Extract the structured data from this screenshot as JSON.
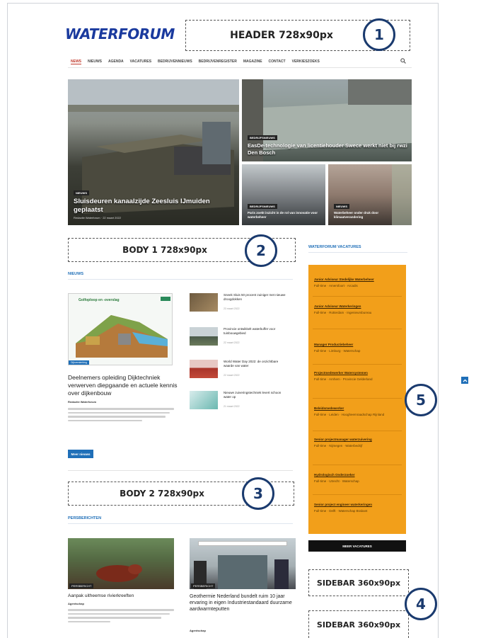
{
  "header": {
    "logo": "WATERFORUM",
    "ad_label": "HEADER 728x90px",
    "badge": "1"
  },
  "nav": {
    "items": [
      "NEWS",
      "NIEUWS",
      "AGENDA",
      "VACATURES",
      "BEDRIJVENNIEUWS",
      "BEDRIJVENREGISTER",
      "MAGAZINE",
      "CONTACT",
      "VERKIESZOEKS"
    ],
    "active": "NEWS",
    "search_icon": "search-icon"
  },
  "hero": {
    "main": {
      "tag": "Nieuws",
      "title": "Sluisdeuren kanaalzijde Zeesluis IJmuiden geplaatst",
      "meta": "Redactie Waterforum · 22 maart 2022"
    },
    "top_right": {
      "tag": "Bedrijfsnieuws",
      "title": "EasDe-technologie van licentiehouder Swece werkt niet bij rwzi Den Bosch"
    },
    "bottom_left": {
      "tag": "Bedrijfsnieuws",
      "title": "Paris zoekt inzicht in de rol van innovatie voor waterbeheer"
    },
    "bottom_right": {
      "tag": "Nieuws",
      "title": "Waterbeheer onder druk door klimaatverandering"
    }
  },
  "body1": {
    "ad_label": "BODY 1 728x90px",
    "badge": "2"
  },
  "nieuws": {
    "section_title": "NIEUWS",
    "feature": {
      "image_caption": "Dijkversterking",
      "image_title": "Golfoploop en -overslag",
      "title": "Deelnemers opleiding Dijktechniek verwerven diepgaande en actuele kennis over dijkenbouw",
      "meta": "Redactie Waterforum",
      "button": "Meer nieuws"
    },
    "list": [
      {
        "title": "Sneek Sluis 50 procent zuiniger met nieuwe droogdokken",
        "date": "23 maart 2022"
      },
      {
        "title": "Provincie ontwikkelt waterbuffer voor tuinbouwgebied",
        "date": "22 maart 2022"
      },
      {
        "title": "World Water Day 2022: de onzichtbare waarde van water",
        "date": "22 maart 2022"
      },
      {
        "title": "Nieuwe zuiveringstechniek levert schoon water op",
        "date": "21 maart 2022"
      }
    ]
  },
  "body2": {
    "ad_label": "BODY 2 728x90px",
    "badge": "3"
  },
  "persberichten": {
    "section_title": "PERSBERICHTEN",
    "items": [
      {
        "tag": "Persbericht",
        "title": "Aanpak uitheemse rivierkreeften",
        "meta": "Agentschap"
      },
      {
        "tag": "Persbericht",
        "title": "Geothermie Nederland bundelt ruim 10 jaar ervaring in eigen Industriestandaard duurzame aardwarmteputten",
        "meta": "Agentschap"
      }
    ]
  },
  "sidebar": {
    "section_title": "WATERFORUM VACATURES",
    "badge": "5",
    "vacancies": [
      {
        "title": "Junior Adviseur Stedelijke Waterbeheer",
        "sub": "Full-time · Amersfoort · Arcadis"
      },
      {
        "title": "Junior Adviseur Waterkeringen",
        "sub": "Full-time · Rotterdam · Ingenieursbureau"
      },
      {
        "title": "Manager Productiebeheer",
        "sub": "Full-time · Limburg · Waterschap"
      },
      {
        "title": "Projectmedewerker Watersystemen",
        "sub": "Full-time · Arnhem · Provincie Gelderland"
      },
      {
        "title": "Beleidsmedewerker",
        "sub": "Full-time · Leiden · Hoogheemraadschap Rijnland"
      },
      {
        "title": "Senior projectmanager waterzuivering",
        "sub": "Full-time · Nijmegen · Waterbedrijf"
      },
      {
        "title": "Hydrologisch Onderzoeker",
        "sub": "Full-time · Utrecht · Waterschap"
      },
      {
        "title": "Senior project engineer waterkeringen",
        "sub": "Full-time · Delft · Waterschap Brabant"
      }
    ],
    "button": "Meer vacatures",
    "ad1_label": "SIDEBAR 360x90px",
    "ad2_label": "SIDEBAR 360x90px",
    "ad_badge": "4"
  },
  "colors": {
    "brand": "#1a3a9e",
    "accent": "#1f6fb8",
    "vacature_bg": "#f29f1a",
    "badge_border": "#1a3a6e",
    "nav_active": "#c0392b"
  }
}
